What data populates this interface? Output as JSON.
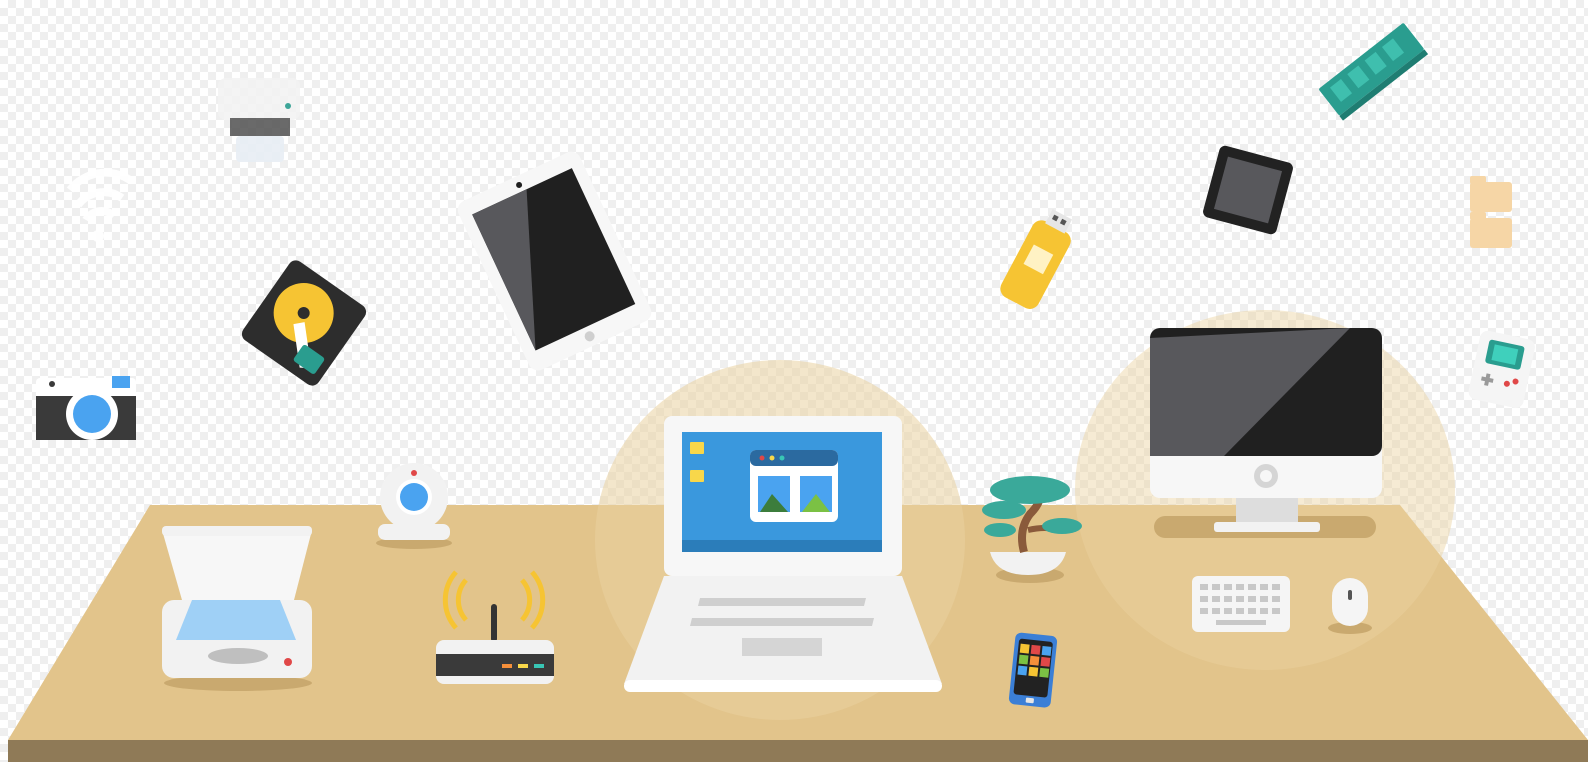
{
  "scene": {
    "colors": {
      "desk": "#e2c48b",
      "desk_edge": "#8f7a57",
      "desk_shadow": "#c9a96f",
      "screen_dark": "#202020",
      "screen_gray": "#58585c",
      "laptop_screen": "#3a98dd",
      "laptop_body": "#f2f2f2",
      "accent_yellow": "#f6c433",
      "accent_teal": "#2a9d8f",
      "accent_blue": "#4aa3f0",
      "router_led_orange": "#f58f3a",
      "router_led_yellow": "#f8d74a",
      "router_led_teal": "#38c6b5",
      "bonsai_green": "#3aa99a",
      "bonsai_trunk": "#8a5a3b",
      "phone_blue": "#3b7fd6"
    },
    "objects": [
      "printer-icon",
      "wifi-icon",
      "hard-drive-icon",
      "camera-icon",
      "tablet-icon",
      "usb-drive-icon",
      "cpu-chip-icon",
      "ram-stick-icon",
      "folders-icon",
      "game-console-icon",
      "webcam-icon",
      "scanner-icon",
      "router-icon",
      "laptop-icon",
      "bonsai-plant-icon",
      "smartphone-icon",
      "desktop-monitor-icon",
      "keyboard-icon",
      "mouse-icon"
    ]
  }
}
